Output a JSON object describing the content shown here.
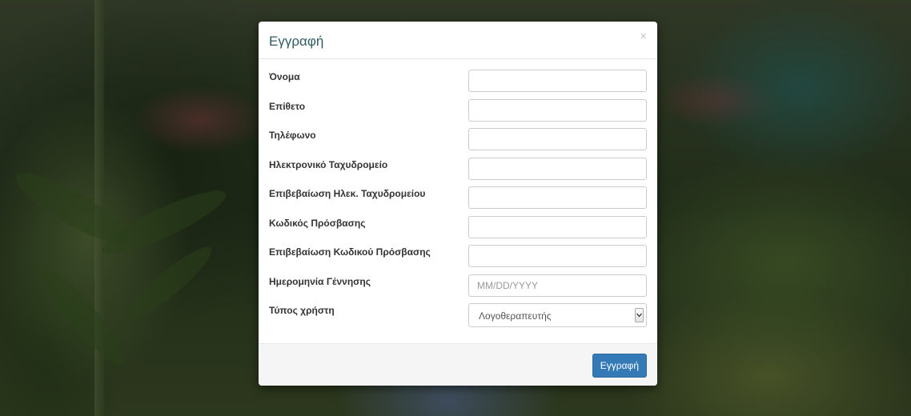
{
  "modal": {
    "title": "Εγγραφή",
    "close_symbol": "×",
    "fields": [
      {
        "label": "Όνομα",
        "value": "",
        "placeholder": ""
      },
      {
        "label": "Επίθετο",
        "value": "",
        "placeholder": ""
      },
      {
        "label": "Τηλέφωνο",
        "value": "",
        "placeholder": ""
      },
      {
        "label": "Ηλεκτρονικό Ταχυδρομείο",
        "value": "",
        "placeholder": ""
      },
      {
        "label": "Επιβεβαίωση Ηλεκ. Ταχυδρομείου",
        "value": "",
        "placeholder": ""
      },
      {
        "label": "Κωδικός Πρόσβασης",
        "value": "",
        "placeholder": ""
      },
      {
        "label": "Επιβεβαίωση Κωδικού Πρόσβασης",
        "value": "",
        "placeholder": ""
      },
      {
        "label": "Ημερομηνία Γέννησης",
        "value": "",
        "placeholder": "MM/DD/YYYY"
      }
    ],
    "user_type": {
      "label": "Τύπος χρήστη",
      "selected": "Λογοθεραπευτής"
    },
    "submit_label": "Εγγραφή"
  },
  "colors": {
    "title": "#2f5b60",
    "primary_button": "#337ab7",
    "footer_background": "#f5f5f5"
  },
  "icons": {
    "close": "close-icon",
    "select_arrow": "chevron-down-icon"
  }
}
